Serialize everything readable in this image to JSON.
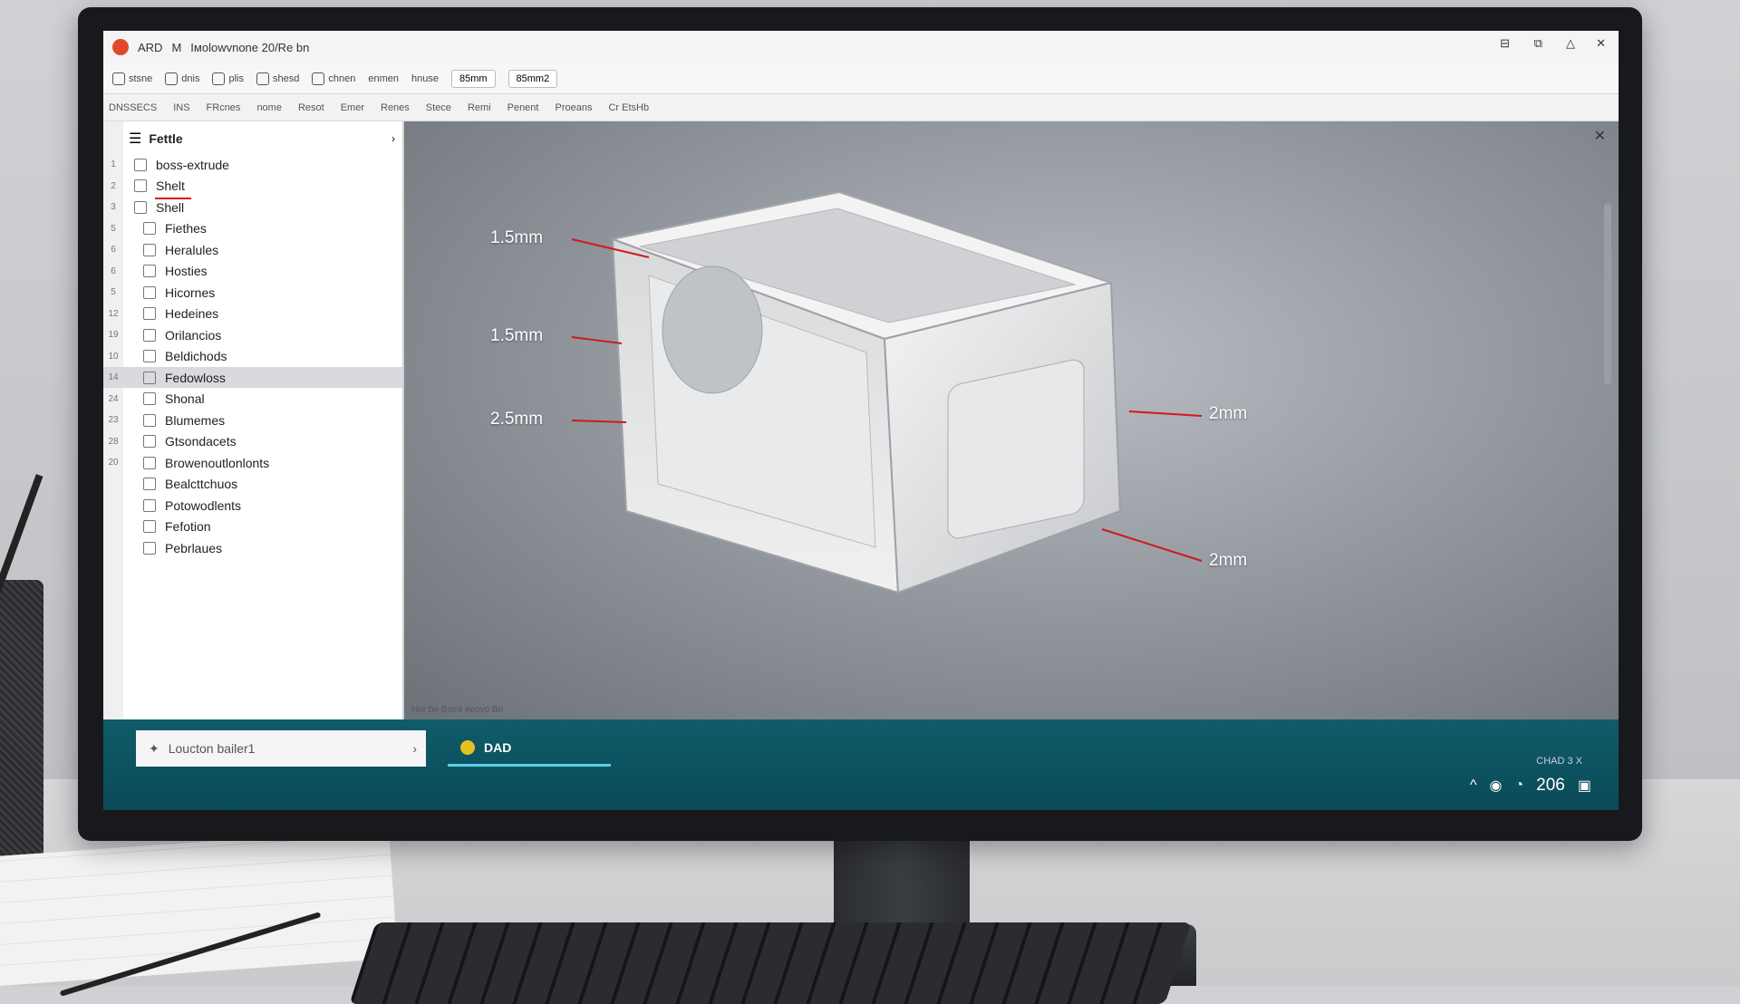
{
  "titlebar": {
    "app": "ARD",
    "menu_short": "M",
    "title": "Iмolowvnone 20/Re bn"
  },
  "toolbar": {
    "tools": [
      "stsne",
      "dnis",
      "plis",
      "shesd",
      "chnen",
      "enmen",
      "hnuse"
    ],
    "units_value": "85mm",
    "area_value": "85mm2"
  },
  "menubar": [
    "DNSSECS",
    "INS",
    "FRcnes",
    "nome",
    "Resot",
    "Emer",
    "Renes",
    "Stece",
    "Remi",
    "Penent",
    "Proeans",
    "Cr EtsHb"
  ],
  "tree": {
    "header": "Fettle",
    "rows": [
      {
        "ln": "1",
        "label": "boss-extrude"
      },
      {
        "ln": "2",
        "label": "Shelt"
      },
      {
        "ln": "3",
        "label": "Shell"
      },
      {
        "ln": "5",
        "label": "Fiethes"
      },
      {
        "ln": "6",
        "label": "Heralules"
      },
      {
        "ln": "6",
        "label": "Hosties"
      },
      {
        "ln": "5",
        "label": "Hicornes"
      },
      {
        "ln": "12",
        "label": "Hedeines"
      },
      {
        "ln": "19",
        "label": "Orilancios"
      },
      {
        "ln": "10",
        "label": "Beldichods"
      },
      {
        "ln": "14",
        "label": "Fedowloss"
      },
      {
        "ln": "24",
        "label": "Shonal"
      },
      {
        "ln": "23",
        "label": "Blumemes"
      },
      {
        "ln": "28",
        "label": "Gtsondacets"
      },
      {
        "ln": "20",
        "label": "Browenoutlonlonts"
      },
      {
        "ln": "",
        "label": "Bealcttchuos"
      },
      {
        "ln": "",
        "label": "Potowodlents"
      },
      {
        "ln": "",
        "label": "Fefotion"
      },
      {
        "ln": "",
        "label": "Pebrlaues"
      }
    ]
  },
  "viewport": {
    "dimensions": [
      "1.5mm",
      "1.5mm",
      "2.5mm",
      "2mm",
      "2mm"
    ]
  },
  "status": {
    "text": "Hor be Botrit #eovo Bn"
  },
  "taskbar": {
    "search_label": "Loucton bailer1",
    "app_label": "DAD",
    "chad": "CHAD 3 X",
    "clock": "206"
  },
  "colors": {
    "taskbar": "#0f5c6a",
    "dimension_line": "#d01a1a",
    "accent_logo": "#e04a2a"
  }
}
